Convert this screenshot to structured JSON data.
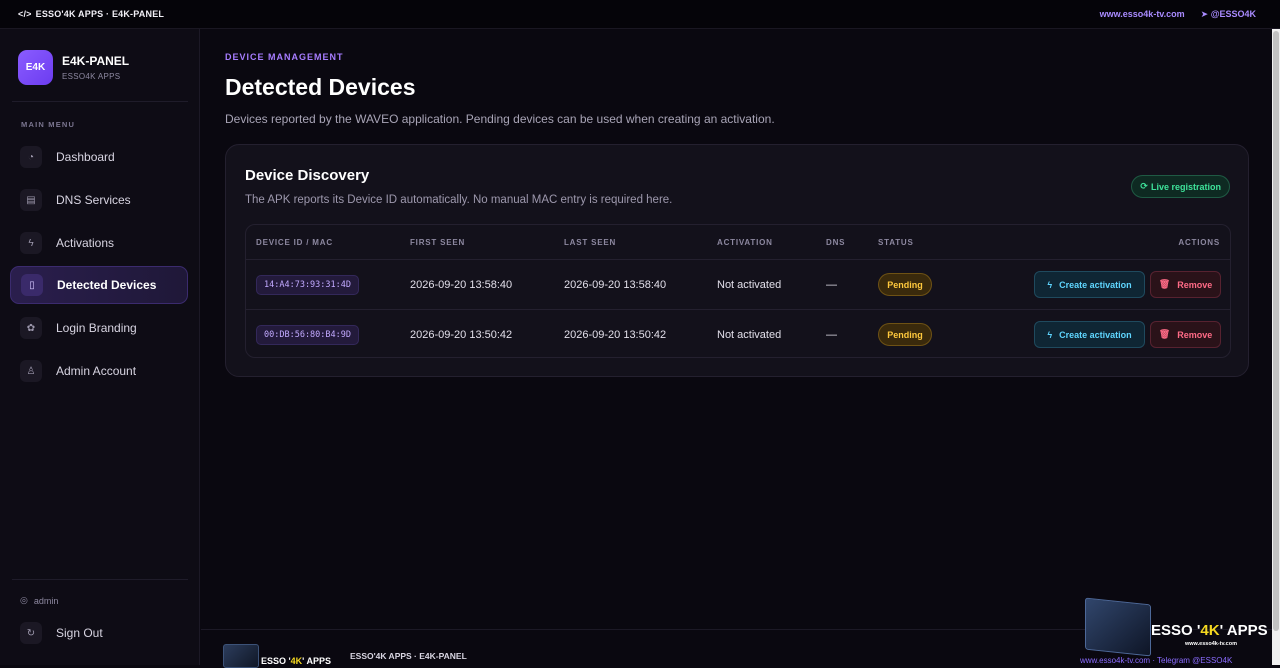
{
  "topbar": {
    "brand_icon": "code-icon",
    "brand": "ESSO'4K APPS · E4K-PANEL",
    "website": "www.esso4k-tv.com",
    "telegram": "@ESSO4K"
  },
  "sidebar": {
    "logo_mark": "E4K",
    "logo_title": "E4K-PANEL",
    "logo_sub": "ESSO4K APPS",
    "menu_label": "MAIN MENU",
    "items": [
      {
        "label": "Dashboard",
        "icon": "gauge-icon"
      },
      {
        "label": "DNS Services",
        "icon": "server-icon"
      },
      {
        "label": "Activations",
        "icon": "bolt-icon"
      },
      {
        "label": "Detected Devices",
        "icon": "device-icon",
        "active": true
      },
      {
        "label": "Login Branding",
        "icon": "palette-icon"
      },
      {
        "label": "Admin Account",
        "icon": "user-cog-icon"
      }
    ],
    "user": "admin",
    "signout": "Sign Out"
  },
  "main": {
    "eyebrow": "DEVICE MANAGEMENT",
    "title": "Detected Devices",
    "description": "Devices reported by the WAVEO application. Pending devices can be used when creating an activation."
  },
  "card": {
    "title": "Device Discovery",
    "description": "The APK reports its Device ID automatically. No manual MAC entry is required here.",
    "badge": "Live registration"
  },
  "table": {
    "columns": [
      "DEVICE ID / MAC",
      "FIRST SEEN",
      "LAST SEEN",
      "ACTIVATION",
      "DNS",
      "STATUS",
      "ACTIONS"
    ],
    "rows": [
      {
        "device_id": "14:A4:73:93:31:4D",
        "first_seen": "2026-09-20 13:58:40",
        "last_seen": "2026-09-20 13:58:40",
        "activation": "Not activated",
        "dns": "—",
        "status": "Pending",
        "create_label": "Create activation",
        "remove_label": "Remove"
      },
      {
        "device_id": "00:DB:56:80:B4:9D",
        "first_seen": "2026-09-20 13:50:42",
        "last_seen": "2026-09-20 13:50:42",
        "activation": "Not activated",
        "dns": "—",
        "status": "Pending",
        "create_label": "Create activation",
        "remove_label": "Remove"
      }
    ]
  },
  "footer": {
    "logo_pre": "ESSO '",
    "logo_hl": "4K",
    "logo_post": "' APPS",
    "text": "ESSO'4K APPS · E4K-PANEL"
  },
  "watermark": {
    "title_pre": "ESSO '",
    "title_hl": "4K",
    "title_post": "' APPS",
    "url": "www.esso4k-tv.com",
    "links": "www.esso4k-tv.com  ·  Telegram @ESSO4K"
  },
  "colors": {
    "accent": "#8a5cff",
    "success": "#3ee39a",
    "warning": "#ffc93d",
    "info": "#5fd6ff",
    "danger": "#ff6b86"
  }
}
